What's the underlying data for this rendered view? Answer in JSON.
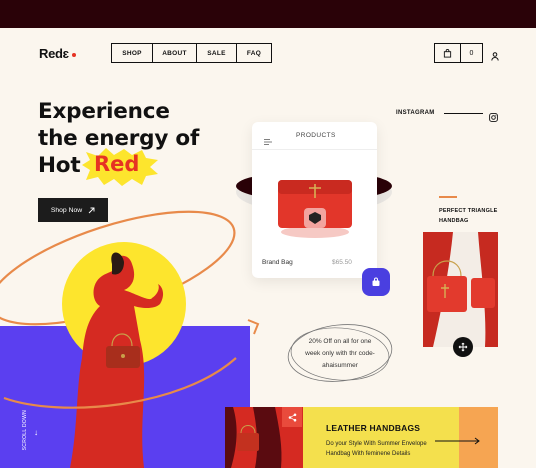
{
  "brand": {
    "name": "Redɛ",
    "accent": "#e63323"
  },
  "nav": {
    "items": [
      {
        "label": "SHOP",
        "w": 41
      },
      {
        "label": "ABOUT",
        "w": 44
      },
      {
        "label": "SALE",
        "w": 40
      },
      {
        "label": "FAQ",
        "w": 34
      }
    ]
  },
  "cart": {
    "count": "0"
  },
  "hero": {
    "line1": "Experience",
    "line2": "the energy of",
    "line3_prefix": "Hot",
    "highlight": "Red",
    "cta": "Shop Now"
  },
  "social": {
    "label": "INSTAGRAM"
  },
  "products_card": {
    "title": "PRODUCTS",
    "item_name": "Brand Bag",
    "item_price": "$65.50"
  },
  "side_feature": {
    "label_line1": "PERFECT TRIANGLE",
    "label_line2": "HANDBAG"
  },
  "promo": {
    "line1": "20% Off on all for one",
    "line2": "week only with thr code-",
    "line3": "ahaisummer"
  },
  "scroll": {
    "label": "SCROLL DOWN"
  },
  "banner": {
    "title": "LEATHER HANDBAGS",
    "desc1": "Do your Style With Summer Envelope",
    "desc2": "Handbag With feminene Details"
  },
  "colors": {
    "dark": "#2a0208",
    "purple": "#5b3ff0",
    "yellow": "#fde52d",
    "orange": "#e88a4a",
    "red": "#e63323"
  }
}
